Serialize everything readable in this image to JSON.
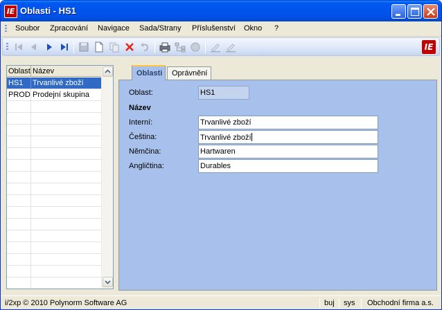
{
  "window": {
    "app_icon_text": "IE",
    "title": "Oblasti - HS1"
  },
  "menu": {
    "items": [
      "Soubor",
      "Zpracování",
      "Navigace",
      "Sada/Strany",
      "Příslušenství",
      "Okno",
      "?"
    ]
  },
  "toolbar": {
    "icons": [
      "first-record-icon",
      "previous-record-icon",
      "next-record-icon",
      "last-record-icon",
      "save-icon",
      "new-icon",
      "copy-icon",
      "delete-icon",
      "undo-icon",
      "print-icon",
      "tree-icon",
      "stop-icon",
      "edit-icon",
      "edit-alt-icon"
    ],
    "logo_text": "IE"
  },
  "list": {
    "columns": [
      "Oblast",
      "Název"
    ],
    "rows": [
      {
        "code": "HS1",
        "name": "Trvanlivé zboží",
        "selected": true
      },
      {
        "code": "PROD",
        "name": "Prodejní skupina",
        "selected": false
      }
    ],
    "empty_rows": 16
  },
  "tabs": [
    {
      "label": "Oblasti",
      "active": true
    },
    {
      "label": "Oprávnění",
      "active": false
    }
  ],
  "form": {
    "oblast_label": "Oblast:",
    "oblast_value": "HS1",
    "section_title": "Název",
    "interni_label": "Interní:",
    "interni_value": "Trvanlivé zboží",
    "cestina_label": "Čeština:",
    "cestina_value": "Trvanlivé zboží",
    "nemcina_label": "Němčina:",
    "nemcina_value": "Hartwaren",
    "anglictina_label": "Angličtina:",
    "anglictina_value": "Durables"
  },
  "status": {
    "copyright": "i/2xp © 2010 Polynorm Software AG",
    "user": "buj",
    "system": "sys",
    "company": "Obchodní firma a.s."
  },
  "colors": {
    "titlebar": "#0054E3",
    "selection": "#316AC5",
    "panel": "#A8C1EC",
    "brand": "#C00000"
  }
}
